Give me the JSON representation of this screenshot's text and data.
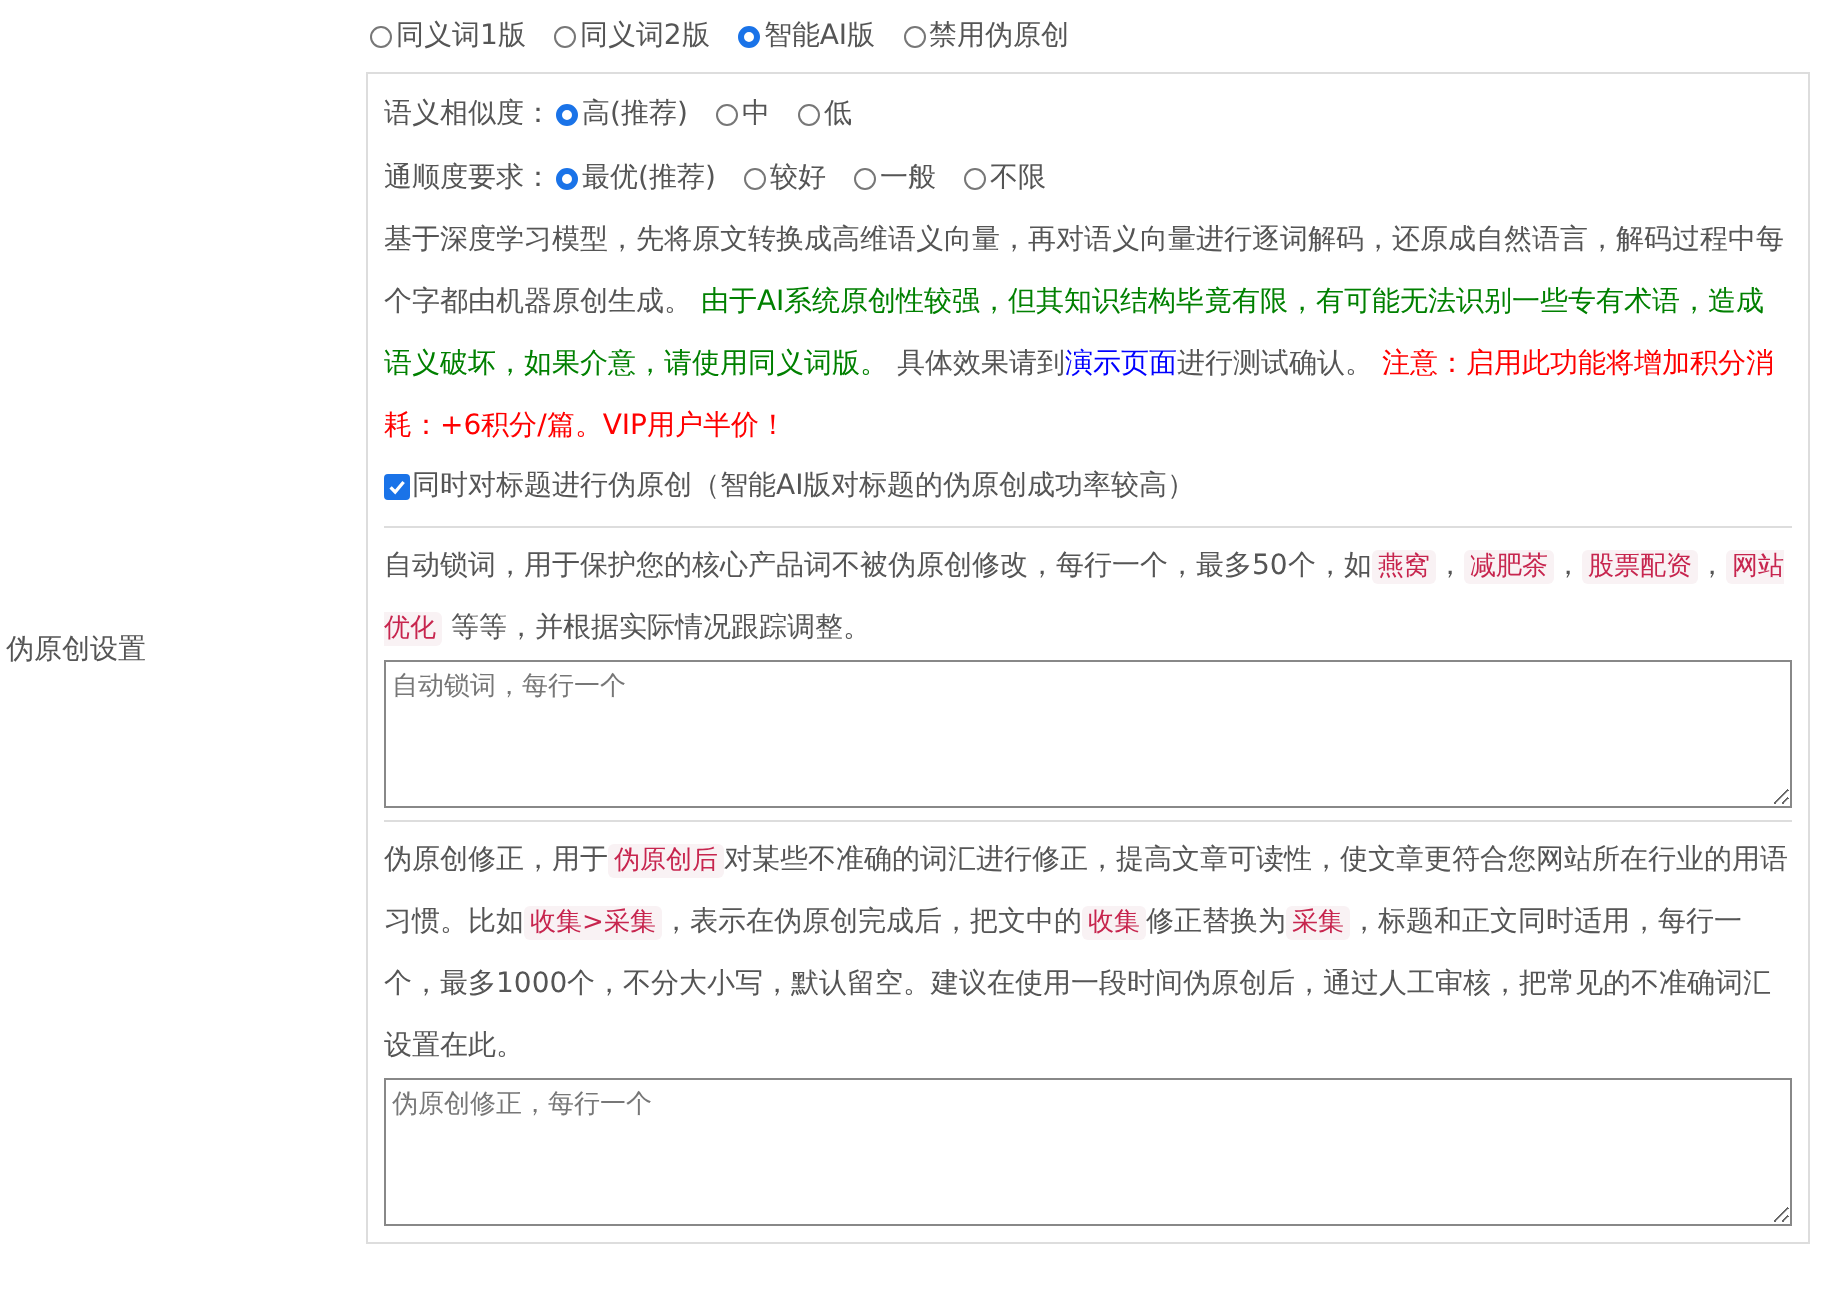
{
  "left_label": "伪原创设置",
  "modes": [
    {
      "label": "同义词1版",
      "selected": false
    },
    {
      "label": "同义词2版",
      "selected": false
    },
    {
      "label": "智能AI版",
      "selected": true
    },
    {
      "label": "禁用伪原创",
      "selected": false
    }
  ],
  "similarity": {
    "label": "语义相似度：",
    "options": [
      {
        "label": "高(推荐)",
        "selected": true
      },
      {
        "label": "中",
        "selected": false
      },
      {
        "label": "低",
        "selected": false
      }
    ]
  },
  "fluency": {
    "label": "通顺度要求：",
    "options": [
      {
        "label": "最优(推荐)",
        "selected": true
      },
      {
        "label": "较好",
        "selected": false
      },
      {
        "label": "一般",
        "selected": false
      },
      {
        "label": "不限",
        "selected": false
      }
    ]
  },
  "description": [
    {
      "kind": "text",
      "text": "基于深度学习模型，先将原文转换成高维语义向量，再对语义向量进行逐词解码，还原成自然语言，解码过程中每个字都由机器原创生成。 "
    },
    {
      "kind": "notice",
      "text": "由于AI系统原创性较强，但其知识结构毕竟有限，有可能无法识别一些专有术语，造成语义破坏，如果介意，请使用同义词版。"
    },
    {
      "kind": "text",
      "text": " 具体效果请到"
    },
    {
      "kind": "link",
      "text": "演示页面"
    },
    {
      "kind": "text",
      "text": "进行测试确认。 "
    },
    {
      "kind": "warning",
      "text": "注意：启用此功能将增加积分消耗：+6积分/篇。VIP用户半价！"
    }
  ],
  "title_option": {
    "label": "同时对标题进行伪原创（智能AI版对标题的伪原创成功率较高）",
    "checked": true
  },
  "lock_words": {
    "description": [
      {
        "kind": "text",
        "text": "自动锁词，用于保护您的核心产品词不被伪原创修改，每行一个，最多50个，如"
      },
      {
        "kind": "code",
        "text": "燕窝"
      },
      {
        "kind": "text",
        "text": "，"
      },
      {
        "kind": "code",
        "text": "减肥茶"
      },
      {
        "kind": "text",
        "text": "，"
      },
      {
        "kind": "code",
        "text": "股票配资"
      },
      {
        "kind": "text",
        "text": "，"
      },
      {
        "kind": "code",
        "text": "网站优化"
      },
      {
        "kind": "text",
        "text": " 等等，并根据实际情况跟踪调整。"
      }
    ],
    "placeholder": "自动锁词，每行一个"
  },
  "corrections": {
    "description": [
      {
        "kind": "text",
        "text": "伪原创修正，用于"
      },
      {
        "kind": "code",
        "text": "伪原创后"
      },
      {
        "kind": "text",
        "text": "对某些不准确的词汇进行修正，提高文章可读性，使文章更符合您网站所在行业的用语习惯。比如"
      },
      {
        "kind": "code",
        "text": "收集>采集"
      },
      {
        "kind": "text",
        "text": "，表示在伪原创完成后，把文中的"
      },
      {
        "kind": "code",
        "text": "收集"
      },
      {
        "kind": "text",
        "text": "修正替换为"
      },
      {
        "kind": "code",
        "text": "采集"
      },
      {
        "kind": "text",
        "text": "，标题和正文同时适用，每行一个，最多1000个，不分大小写，默认留空。建议在使用一段时间伪原创后，通过人工审核，把常见的不准确词汇设置在此。"
      }
    ],
    "placeholder": "伪原创修正，每行一个"
  }
}
